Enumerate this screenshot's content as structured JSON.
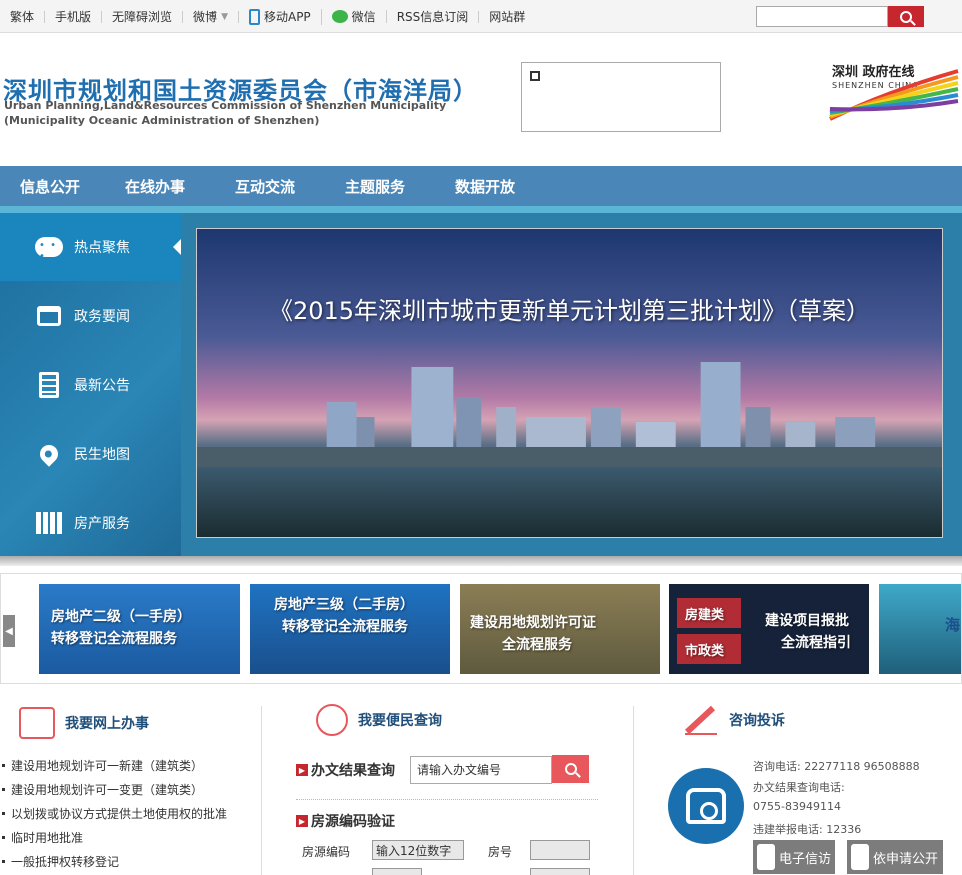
{
  "topbar": {
    "links": [
      "繁体",
      "手机版",
      "无障碍浏览",
      "微博",
      "移动APP",
      "微信",
      "RSS信息订阅",
      "网站群"
    ],
    "search_placeholder": ""
  },
  "header": {
    "title_cn": "深圳市规划和国土资源委员会（市海洋局）",
    "title_en_1": "Urban Planning,Land&Resources Commission of Shenzhen Municipality",
    "title_en_2": "(Municipality Oceanic Administration of Shenzhen)",
    "logo_line1": "深圳 政府在线",
    "logo_line2": "SHENZHEN CHINA"
  },
  "nav": [
    "信息公开",
    "在线办事",
    "互动交流",
    "主题服务",
    "数据开放"
  ],
  "sidebar": [
    {
      "label": "热点聚焦",
      "icon": "chat-icon"
    },
    {
      "label": "政务要闻",
      "icon": "meeting-icon"
    },
    {
      "label": "最新公告",
      "icon": "notice-icon"
    },
    {
      "label": "民生地图",
      "icon": "map-pin-icon"
    },
    {
      "label": "房产服务",
      "icon": "building-icon"
    }
  ],
  "slide": {
    "caption": "《2015年深圳市城市更新单元计划第三批计划》（草案）"
  },
  "banners": [
    {
      "line1": "房地产二级（一手房）",
      "line2": "转移登记全流程服务"
    },
    {
      "line1": "房地产三级（二手房）",
      "line2": "转移登记全流程服务"
    },
    {
      "line1": "建设用地规划许可证",
      "line2": "全流程服务"
    },
    {
      "line1": "房建类",
      "line2": "市政类",
      "line3": "建设项目报批",
      "line4": "全流程指引"
    },
    {
      "line1": "海"
    }
  ],
  "online_service": {
    "title": "我要网上办事",
    "items": [
      "建设用地规划许可一新建（建筑类）",
      "建设用地规划许可一变更（建筑类）",
      "以划拨或协议方式提供土地使用权的批准",
      "临时用地批准",
      "一般抵押权转移登记"
    ]
  },
  "query": {
    "title": "我要便民查询",
    "result_title": "办文结果查询",
    "result_input": "请输入办文编号",
    "house_title": "房源编码验证",
    "house_code_label": "房源编码",
    "house_code_value": "输入12位数字",
    "room_label": "房号"
  },
  "complaint": {
    "title": "咨询投诉",
    "line1": "咨询电话: 22277118 96508888",
    "line2": "办文结果查询电话:",
    "line3": "0755-83949114",
    "line4": "违建举报电话: 12336",
    "btn_mail": "电子信访",
    "btn_apply": "依申请公开"
  }
}
